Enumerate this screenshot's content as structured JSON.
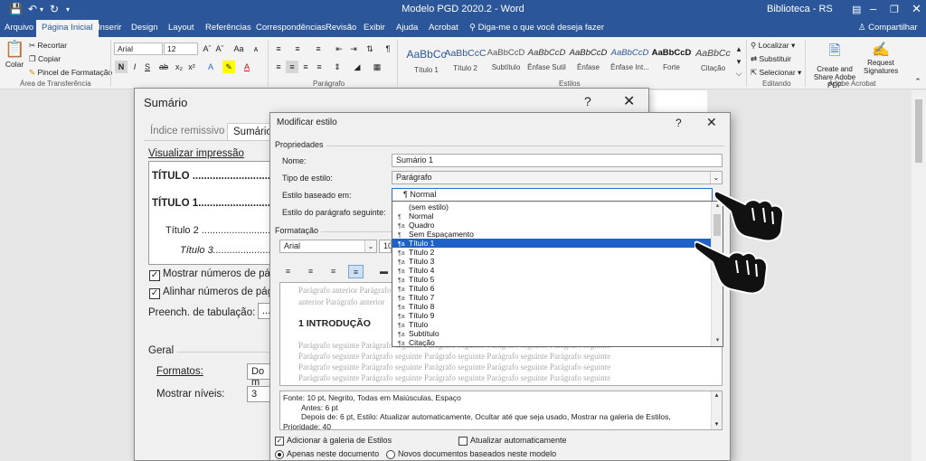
{
  "window": {
    "title": "Modelo PGD 2020.2  -  Word",
    "user": "Biblioteca - RS"
  },
  "tabs": [
    "Arquivo",
    "Página Inicial",
    "Inserir",
    "Design",
    "Layout",
    "Referências",
    "Correspondências",
    "Revisão",
    "Exibir",
    "Ajuda",
    "Acrobat"
  ],
  "tell_me": "Diga-me o que você deseja fazer",
  "share": "Compartilhar",
  "ribbon": {
    "clipboard": {
      "paste": "Colar",
      "cut": "Recortar",
      "copy": "Copiar",
      "format_painter": "Pincel de Formatação",
      "group": "Área de Transferência"
    },
    "font": {
      "name": "Arial",
      "size": "12"
    },
    "paragraph_group": "Parágrafo",
    "styles_group": "Estilos",
    "styles": [
      {
        "sample": "AaBbCc",
        "name": "Título 1"
      },
      {
        "sample": "AaBbCcC",
        "name": "Título 2"
      },
      {
        "sample": "AaBbCcD",
        "name": "Subtítulo"
      },
      {
        "sample": "AaBbCcD",
        "name": "Ênfase Sutil"
      },
      {
        "sample": "AaBbCcD",
        "name": "Ênfase"
      },
      {
        "sample": "AaBbCcD",
        "name": "Ênfase Int..."
      },
      {
        "sample": "AaBbCcD",
        "name": "Forte"
      },
      {
        "sample": "AaBbCc",
        "name": "Citação"
      }
    ],
    "editing": {
      "find": "Localizar",
      "replace": "Substituir",
      "select": "Selecionar",
      "group": "Editando"
    },
    "acrobat": {
      "create": "Create and Share Adobe PDF",
      "request": "Request Signatures",
      "group": "Adobe Acrobat"
    }
  },
  "sumario": {
    "title": "Sumário",
    "tab_indice": "Índice remissivo",
    "tab_sumario": "Sumário",
    "preview_label": "Visualizar impressão",
    "preview_lines": [
      "TÍTULO ...........................",
      "TÍTULO 1...........................",
      "Título 2 ...........................",
      "Título 3..........................."
    ],
    "show_numbers": "Mostrar números de pá",
    "align_numbers": "Alinhar números de pág",
    "tab_leader_label": "Preench. de tabulação:",
    "tab_leader_value": "......",
    "general": "Geral",
    "formats_label": "Formatos:",
    "formats_value": "Do m",
    "levels_label": "Mostrar níveis:",
    "levels_value": "3"
  },
  "modificar": {
    "title": "Modificar estilo",
    "properties": "Propriedades",
    "name_label": "Nome:",
    "name_value": "Sumário 1",
    "type_label": "Tipo de estilo:",
    "type_value": "Parágrafo",
    "based_label": "Estilo baseado em:",
    "based_value": "Normal",
    "next_label": "Estilo do parágrafo seguinte:",
    "formatting": "Formatação",
    "font_value": "Arial",
    "size_value": "10",
    "preview": {
      "prev_1": "Parágrafo anterior Parágrafo anterior",
      "prev_2": "anterior Parágrafo anterior",
      "heading": "1 INTRODUÇÃO",
      "next_line": "Parágrafo seguinte Parágrafo seguinte Parágrafo seguinte Parágrafo seguinte Parágrafo seguinte"
    },
    "description": [
      "Fonte: 10 pt, Negrito, Todas em Maiúsculas, Espaço",
      "Antes:  6 pt",
      "Depois de:  6 pt, Estilo: Atualizar automaticamente, Ocultar até que seja usado, Mostrar na galeria de Estilos,",
      "Prioridade: 40"
    ],
    "add_gallery": "Adicionar à galeria de Estilos",
    "auto_update": "Atualizar automaticamente",
    "only_doc": "Apenas neste documento",
    "new_docs": "Novos documentos baseados neste modelo"
  },
  "dropdown": {
    "items": [
      {
        "icon": "",
        "label": "(sem estilo)"
      },
      {
        "icon": "¶",
        "label": "Normal"
      },
      {
        "icon": "¶a",
        "label": "Quadro"
      },
      {
        "icon": "¶",
        "label": "Sem Espaçamento"
      },
      {
        "icon": "¶a",
        "label": "Título 1"
      },
      {
        "icon": "¶a",
        "label": "Título 2"
      },
      {
        "icon": "¶a",
        "label": "Título 3"
      },
      {
        "icon": "¶a",
        "label": "Título 4"
      },
      {
        "icon": "¶a",
        "label": "Título 5"
      },
      {
        "icon": "¶a",
        "label": "Título 6"
      },
      {
        "icon": "¶a",
        "label": "Título 7"
      },
      {
        "icon": "¶a",
        "label": "Título 8"
      },
      {
        "icon": "¶a",
        "label": "Título 9"
      },
      {
        "icon": "¶a",
        "label": "Título"
      },
      {
        "icon": "¶a",
        "label": "Subtítulo"
      },
      {
        "icon": "¶a",
        "label": "Citação"
      }
    ],
    "selected_index": 4
  },
  "colors": {
    "word_blue": "#2b579a",
    "selection": "#1e62c8"
  }
}
